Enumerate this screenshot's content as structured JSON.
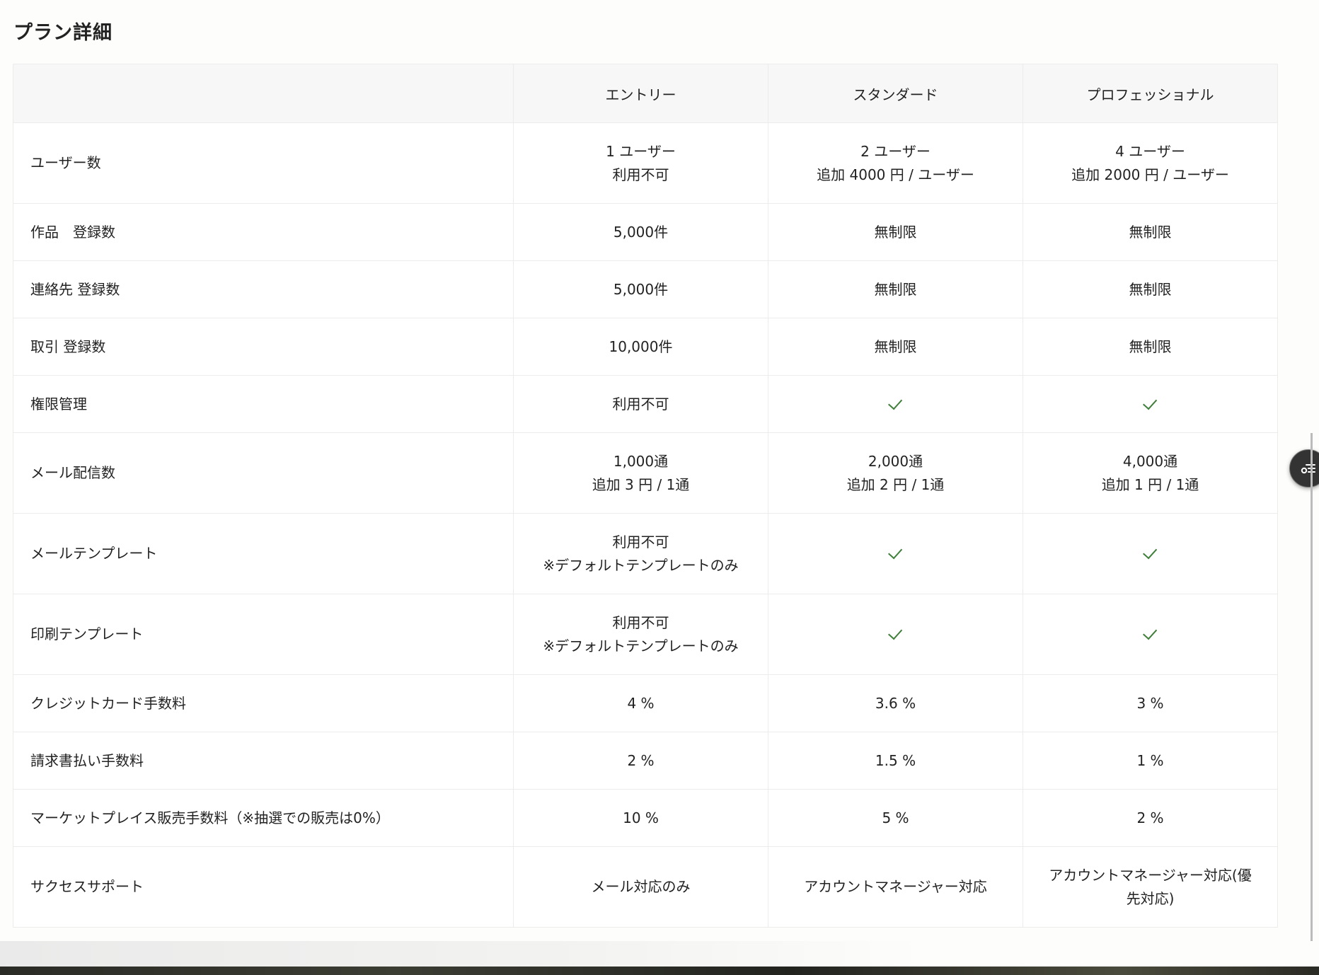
{
  "page_title": "プラン詳細",
  "plans": [
    "エントリー",
    "スタンダード",
    "プロフェッショナル"
  ],
  "rows": [
    {
      "feature": "ユーザー数",
      "values": [
        [
          "1 ユーザー",
          "利用不可"
        ],
        [
          "2 ユーザー",
          "追加 4000 円 / ユーザー"
        ],
        [
          "4 ユーザー",
          "追加 2000 円 / ユーザー"
        ]
      ]
    },
    {
      "feature": "作品　登録数",
      "values": [
        [
          "5,000件"
        ],
        [
          "無制限"
        ],
        [
          "無制限"
        ]
      ]
    },
    {
      "feature": "連絡先 登録数",
      "values": [
        [
          "5,000件"
        ],
        [
          "無制限"
        ],
        [
          "無制限"
        ]
      ]
    },
    {
      "feature": "取引 登録数",
      "values": [
        [
          "10,000件"
        ],
        [
          "無制限"
        ],
        [
          "無制限"
        ]
      ]
    },
    {
      "feature": "権限管理",
      "values": [
        [
          "利用不可"
        ],
        "check",
        "check"
      ]
    },
    {
      "feature": "メール配信数",
      "values": [
        [
          "1,000通",
          "追加 3 円 / 1通"
        ],
        [
          "2,000通",
          "追加 2 円 / 1通"
        ],
        [
          "4,000通",
          "追加 1 円 / 1通"
        ]
      ]
    },
    {
      "feature": "メールテンプレート",
      "values": [
        [
          "利用不可",
          "※デフォルトテンプレートのみ"
        ],
        "check",
        "check"
      ]
    },
    {
      "feature": "印刷テンプレート",
      "values": [
        [
          "利用不可",
          "※デフォルトテンプレートのみ"
        ],
        "check",
        "check"
      ]
    },
    {
      "feature": "クレジットカード手数料",
      "values": [
        [
          "4 %"
        ],
        [
          "3.6 %"
        ],
        [
          "3 %"
        ]
      ]
    },
    {
      "feature": "請求書払い手数料",
      "values": [
        [
          "2 %"
        ],
        [
          "1.5 %"
        ],
        [
          "1 %"
        ]
      ]
    },
    {
      "feature": "マーケットプレイス販売手数料（※抽選での販売は0%）",
      "values": [
        [
          "10 %"
        ],
        [
          "5 %"
        ],
        [
          "2 %"
        ]
      ]
    },
    {
      "feature": "サクセスサポート",
      "values": [
        [
          "メール対応のみ"
        ],
        [
          "アカウントマネージャー対応"
        ],
        [
          "アカウントマネージャー対応(優",
          "先対応)"
        ]
      ]
    }
  ],
  "icons": {
    "check": "check-icon",
    "fab": "list-settings-icon"
  },
  "colors": {
    "check": "#3f7f3a",
    "fab": "#333333"
  }
}
